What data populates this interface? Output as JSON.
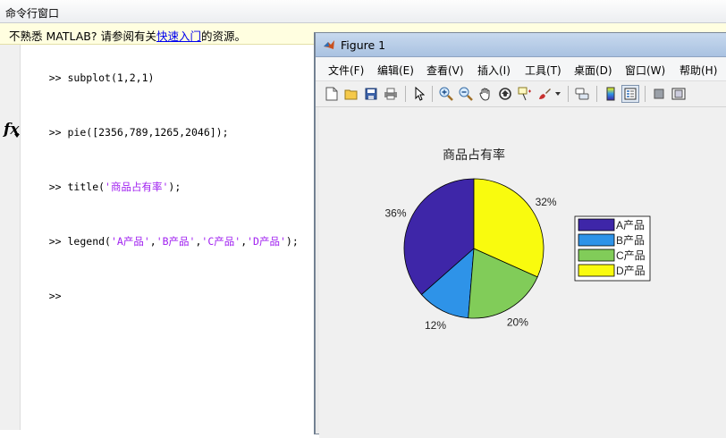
{
  "command_window": {
    "title": "命令行窗口",
    "info_prefix": "不熟悉 MATLAB? 请参阅有关",
    "info_link": "快速入门",
    "info_suffix": "的资源。",
    "prompt": ">>",
    "fx_label": "fx",
    "lines": [
      {
        "code_before": "subplot(1,2,1)",
        "strings": []
      },
      {
        "code_before": "pie([2356,789,1265,2046]);",
        "strings": []
      },
      {
        "code_before": "title(",
        "strings": [
          "'商品占有率'"
        ],
        "code_after": ");"
      },
      {
        "code_before": "legend(",
        "strings": [
          "'A产品'",
          "'B产品'",
          "'C产品'",
          "'D产品'"
        ],
        "code_after": ");"
      }
    ]
  },
  "figure": {
    "title": "Figure 1",
    "menu": [
      "文件(F)",
      "编辑(E)",
      "查看(V)",
      "插入(I)",
      "工具(T)",
      "桌面(D)",
      "窗口(W)",
      "帮助(H)"
    ],
    "toolbar_icons": [
      "new-file-icon",
      "open-file-icon",
      "save-icon",
      "print-icon",
      "pointer-icon",
      "zoom-in-icon",
      "zoom-out-icon",
      "pan-icon",
      "rotate-icon",
      "data-cursor-icon",
      "brush-icon",
      "link-icon",
      "colorbar-icon",
      "legend-icon",
      "hide-plot-tools-icon",
      "show-plot-tools-icon"
    ]
  },
  "chart_data": {
    "type": "pie",
    "title": "商品占有率",
    "values": [
      2356,
      789,
      1265,
      2046
    ],
    "labels": [
      "36%",
      "12%",
      "20%",
      "32%"
    ],
    "legend": [
      "A产品",
      "B产品",
      "C产品",
      "D产品"
    ],
    "colors": [
      "#3e26a8",
      "#2e93e8",
      "#81cc59",
      "#f9fb0e"
    ],
    "legend_position": "right"
  }
}
